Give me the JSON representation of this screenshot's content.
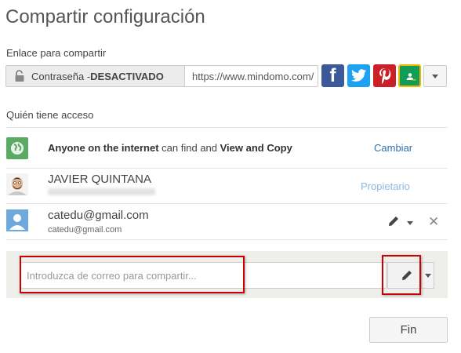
{
  "dialog": {
    "title": "Compartir configuración"
  },
  "share_link": {
    "label": "Enlace para compartir",
    "password_label": "Contraseña - ",
    "password_state": "DESACTIVADO",
    "url": "https://www.mindomo.com/",
    "social_icons": [
      "facebook-icon",
      "twitter-icon",
      "pinterest-icon",
      "google-classroom-icon"
    ],
    "more_dropdown_icon": "chevron-down-icon"
  },
  "access": {
    "label": "Quién tiene acceso",
    "rows": [
      {
        "icon": "globe-icon",
        "text_bold_1": "Anyone on the internet",
        "text_mid": " can find and ",
        "text_bold_2": "View and Copy",
        "action": "Cambiar"
      },
      {
        "icon": "avatar-image",
        "name": "JAVIER QUINTANA",
        "role": "Propietario"
      },
      {
        "icon": "default-user-icon",
        "name": "catedu@gmail.com",
        "email": "catedu@gmail.com",
        "permission_icon": "pencil-icon",
        "remove_icon": "close-icon"
      }
    ]
  },
  "invite": {
    "placeholder": "Introduzca de correo para compartir...",
    "permission_icon": "pencil-icon"
  },
  "footer": {
    "done_label": "Fin"
  },
  "colors": {
    "facebook": "#3b5998",
    "twitter": "#1da1f2",
    "pinterest": "#cb2027",
    "classroom": "#0f9d58",
    "link": "#2f6fad",
    "highlight": "#cc0000"
  }
}
